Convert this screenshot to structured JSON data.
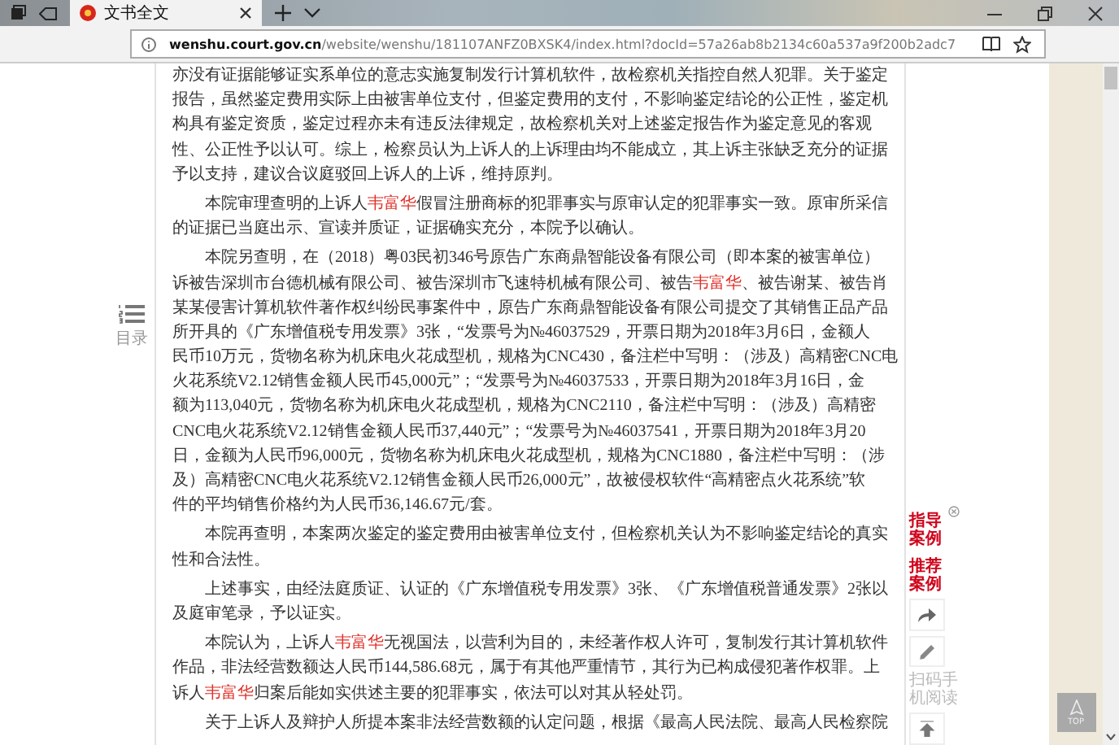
{
  "browser": {
    "tab": {
      "title": "文书全文",
      "selected": true
    },
    "address": {
      "domain": "wenshu.court.gov.cn",
      "path": "/website/wenshu/181107ANFZ0BXSK4/index.html?docId=57a26ab8b2134c60a537a9f200b2adc7"
    }
  },
  "toc": {
    "label": "目录"
  },
  "document": {
    "paragraphs": [
      {
        "kind": "continuation",
        "lines": [
          [
            {
              "text": "亦没有证据能够证实系单位的意志实施复制发行计算机软件，故检察机关指控自然人犯罪。关于鉴定",
              "highlight": false
            }
          ],
          [
            {
              "text": "报告，虽然鉴定费用实际上由被害单位支付，但鉴定费用的支付，不影响鉴定结论的公正性，鉴定机",
              "highlight": false
            }
          ],
          [
            {
              "text": "构具有鉴定资质，鉴定过程亦未有违反法律规定，故检察机关对上述鉴定报告作为鉴定意见的客观",
              "highlight": false
            }
          ],
          [
            {
              "text": "性、公正性予以认可。综上，检察员认为上诉人的上诉理由均不能成立，其上诉主张缺乏充分的证据",
              "highlight": false
            }
          ],
          [
            {
              "text": "予以支持，建议合议庭驳回上诉人的上诉，维持原判。",
              "highlight": false
            }
          ]
        ]
      },
      {
        "kind": "paragraph",
        "lines": [
          [
            {
              "text": "本院审理查明的上诉人",
              "highlight": false
            },
            {
              "text": "韦富华",
              "highlight": true
            },
            {
              "text": "假冒注册商标的犯罪事实与原审认定的犯罪事实一致。原审所采信",
              "highlight": false
            }
          ],
          [
            {
              "text": "的证据已当庭出示、宣读并质证，证据确实充分，本院予以确认。",
              "highlight": false
            }
          ]
        ]
      },
      {
        "kind": "paragraph",
        "lines": [
          [
            {
              "text": "本院另查明，在（2018）粤03民初346号原告广东商鼎智能设备有限公司（即本案的被害单位）",
              "highlight": false
            }
          ],
          [
            {
              "text": "诉被告深圳市台德机械有限公司、被告深圳市飞速特机械有限公司、被告",
              "highlight": false
            },
            {
              "text": "韦富华",
              "highlight": true
            },
            {
              "text": "、被告谢某、被告肖",
              "highlight": false
            }
          ],
          [
            {
              "text": "某某侵害计算机软件著作权纠纷民事案件中，原告广东商鼎智能设备有限公司提交了其销售正品产品",
              "highlight": false
            }
          ],
          [
            {
              "text": "所开具的《广东增值税专用发票》3张，“发票号为№46037529，开票日期为2018年3月6日，金额人",
              "highlight": false
            }
          ],
          [
            {
              "text": "民币10万元，货物名称为机床电火花成型机，规格为CNC430，备注栏中写明：（涉及）高精密CNC电",
              "highlight": false
            }
          ],
          [
            {
              "text": "火花系统V2.12销售金额人民币45,000元”；“发票号为№46037533，开票日期为2018年3月16日，金",
              "highlight": false
            }
          ],
          [
            {
              "text": "额为113,040元，货物名称为机床电火花成型机，规格为CNC2110，备注栏中写明：（涉及）高精密",
              "highlight": false
            }
          ],
          [
            {
              "text": "CNC电火花系统V2.12销售金额人民币37,440元”；“发票号为№46037541，开票日期为2018年3月20",
              "highlight": false
            }
          ],
          [
            {
              "text": "日，金额为人民币96,000元，货物名称为机床电火花成型机，规格为CNC1880，备注栏中写明：（涉",
              "highlight": false
            }
          ],
          [
            {
              "text": "及）高精密CNC电火花系统V2.12销售金额人民币26,000元”，故被侵权软件“高精密点火花系统”软",
              "highlight": false
            }
          ],
          [
            {
              "text": "件的平均销售价格约为人民币36,146.67元/套。",
              "highlight": false
            }
          ]
        ]
      },
      {
        "kind": "paragraph",
        "lines": [
          [
            {
              "text": "本院再查明，本案两次鉴定的鉴定费用由被害单位支付，但检察机关认为不影响鉴定结论的真实",
              "highlight": false
            }
          ],
          [
            {
              "text": "性和合法性。",
              "highlight": false
            }
          ]
        ]
      },
      {
        "kind": "paragraph",
        "lines": [
          [
            {
              "text": "上述事实，由经法庭质证、认证的《广东增值税专用发票》3张、《广东增值税普通发票》2张以",
              "highlight": false
            }
          ],
          [
            {
              "text": "及庭审笔录，予以证实。",
              "highlight": false
            }
          ]
        ]
      },
      {
        "kind": "paragraph",
        "lines": [
          [
            {
              "text": "本院认为，上诉人",
              "highlight": false
            },
            {
              "text": "韦富华",
              "highlight": true
            },
            {
              "text": "无视国法，以营利为目的，未经著作权人许可，复制发行其计算机软件",
              "highlight": false
            }
          ],
          [
            {
              "text": "作品，非法经营数额达人民币144,586.68元，属于有其他严重情节，其行为已构成侵犯著作权罪。上",
              "highlight": false
            }
          ],
          [
            {
              "text": "诉人",
              "highlight": false
            },
            {
              "text": "韦富华",
              "highlight": true
            },
            {
              "text": "归案后能如实供述主要的犯罪事实，依法可以对其从轻处罚。",
              "highlight": false
            }
          ]
        ]
      },
      {
        "kind": "paragraph",
        "lines": [
          [
            {
              "text": "关于上诉人及辩护人所提本案非法经营数额的认定问题，根据《最高人民法院、最高人民检察院",
              "highlight": false
            }
          ]
        ]
      }
    ]
  },
  "sidebar": {
    "case_links": [
      "指导案例",
      "推荐案例"
    ],
    "qr_label": "扫码手机阅读"
  },
  "top_button": {
    "label": "TOP"
  }
}
